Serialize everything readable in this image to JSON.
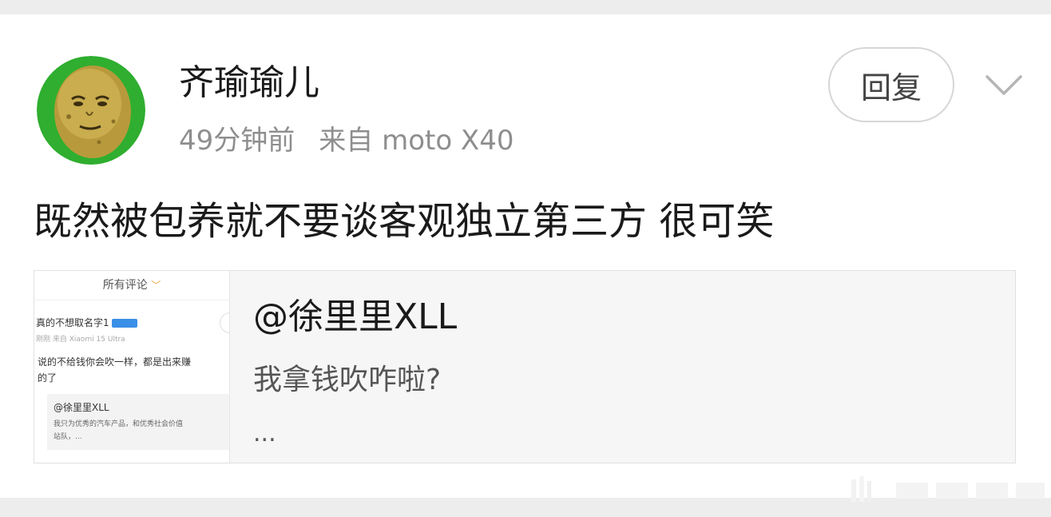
{
  "post": {
    "username": "齐瑜瑜儿",
    "time": "49分钟前",
    "source": "来自 moto X40",
    "content": "既然被包养就不要谈客观独立第三方 很可笑"
  },
  "actions": {
    "reply_label": "回复"
  },
  "quote": {
    "thumbnail": {
      "header": "所有评论",
      "user": "真的不想取名字1",
      "meta": "刚刚 来自 Xiaomi 15 Ultra",
      "text_line1": "说的不给钱你会吹一样，都是出来赚",
      "text_line2": "的了",
      "quoted_name": "@徐里里XLL",
      "quoted_line1": "我只为优秀的汽车产品，和优秀社会价值",
      "quoted_line2": "站队，..."
    },
    "name": "@徐里里XLL",
    "text": "我拿钱吹咋啦?",
    "ellipsis": "..."
  },
  "icons": {
    "expand": "chevron-down-icon",
    "avatar": "potato-face-avatar"
  },
  "colors": {
    "avatar_bg": "#2fae2f",
    "secondary_text": "#8e8e8e"
  }
}
